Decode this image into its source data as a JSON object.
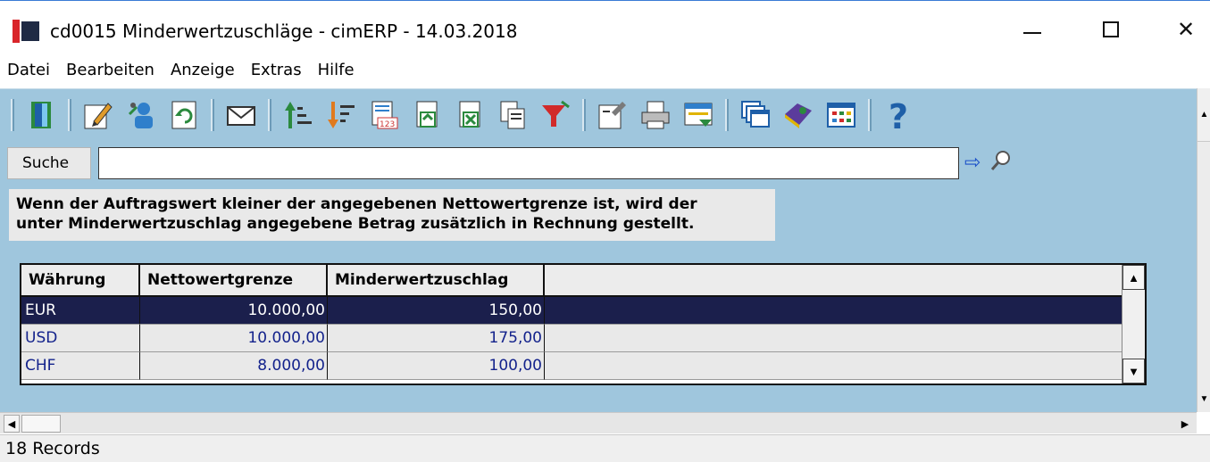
{
  "window": {
    "title": "cd0015 Minderwertzuschläge - cimERP - 14.03.2018",
    "minimize": "—",
    "maximize": "☐",
    "close": "✕"
  },
  "menu": {
    "items": [
      "Datei",
      "Bearbeiten",
      "Anzeige",
      "Extras",
      "Hilfe"
    ]
  },
  "toolbar": {
    "icons": [
      "exit-door-icon",
      "edit-pencil-icon",
      "copy-person-icon",
      "refresh-icon",
      "mail-icon",
      "sort-ascending-icon",
      "sort-descending-icon",
      "number-list-icon",
      "export-icon",
      "excel-icon",
      "copy-document-icon",
      "filter-icon",
      "properties-icon",
      "print-icon",
      "layout-icon",
      "windows-icon",
      "help-book-icon",
      "table-icon",
      "help-question-icon"
    ]
  },
  "search": {
    "label": "Suche",
    "value": ""
  },
  "info": {
    "line1": "Wenn der Auftragswert kleiner der angegebenen Nettowertgrenze ist, wird der",
    "line2": "unter Minderwertzuschlag angegebene Betrag zusätzlich in Rechnung gestellt."
  },
  "grid": {
    "columns": [
      "Währung",
      "Nettowertgrenze",
      "Minderwertzuschlag",
      ""
    ],
    "rows": [
      {
        "currency": "EUR",
        "limit": "10.000,00",
        "surcharge": "150,00",
        "selected": true
      },
      {
        "currency": "USD",
        "limit": "10.000,00",
        "surcharge": "175,00",
        "selected": false
      },
      {
        "currency": "CHF",
        "limit": "8.000,00",
        "surcharge": "100,00",
        "selected": false
      }
    ]
  },
  "status": {
    "records": "18 Records"
  },
  "colors": {
    "pane": "#9fc6dd",
    "selected_row": "#1b1f4c",
    "row_text": "#14238c"
  }
}
